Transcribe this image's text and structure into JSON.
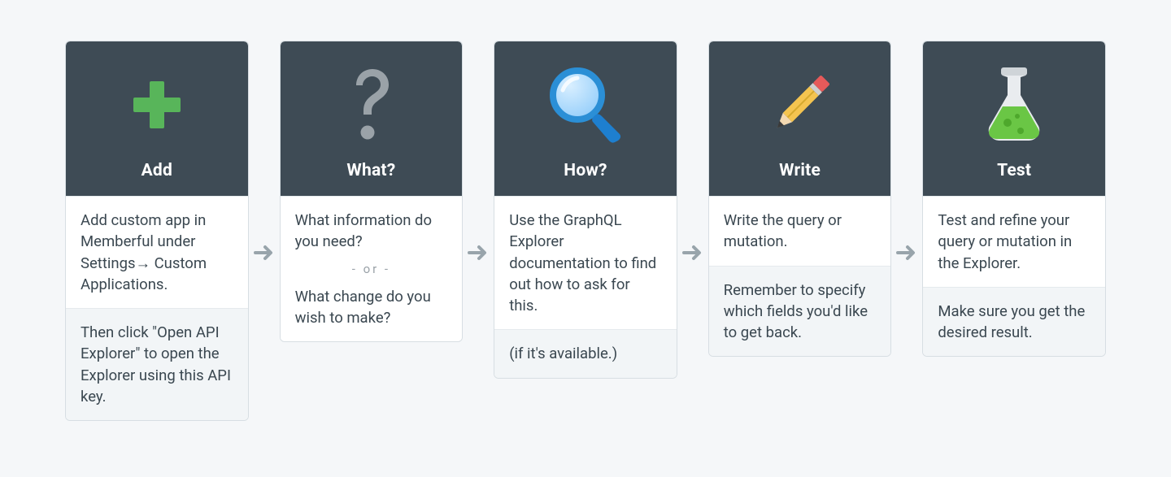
{
  "flow": {
    "steps": [
      {
        "icon": "plus-icon",
        "title": "Add",
        "cells": [
          {
            "type": "text",
            "value": "Add custom app in Memberful under Settings→ Custom Applications."
          },
          {
            "type": "note",
            "value": "Then click \"Open API Explorer\" to open the Explorer using this API key."
          }
        ]
      },
      {
        "icon": "question-icon",
        "title": "What?",
        "cells": [
          {
            "type": "or-split",
            "before": "What information do you need?",
            "or": "- or -",
            "after": "What change do you wish to make?"
          }
        ]
      },
      {
        "icon": "magnifier-icon",
        "title": "How?",
        "cells": [
          {
            "type": "text",
            "value": "Use the GraphQL Explorer documentation to find out how to ask for this."
          },
          {
            "type": "note",
            "value": "(if it's available.)"
          }
        ]
      },
      {
        "icon": "pencil-icon",
        "title": "Write",
        "cells": [
          {
            "type": "text",
            "value": "Write the query or mutation."
          },
          {
            "type": "note",
            "value": "Remember to specify which fields you'd like to get back."
          }
        ]
      },
      {
        "icon": "flask-icon",
        "title": "Test",
        "cells": [
          {
            "type": "text",
            "value": "Test and refine your query or mutation in the Explorer."
          },
          {
            "type": "note",
            "value": "Make sure you get the desired result."
          }
        ]
      }
    ]
  }
}
